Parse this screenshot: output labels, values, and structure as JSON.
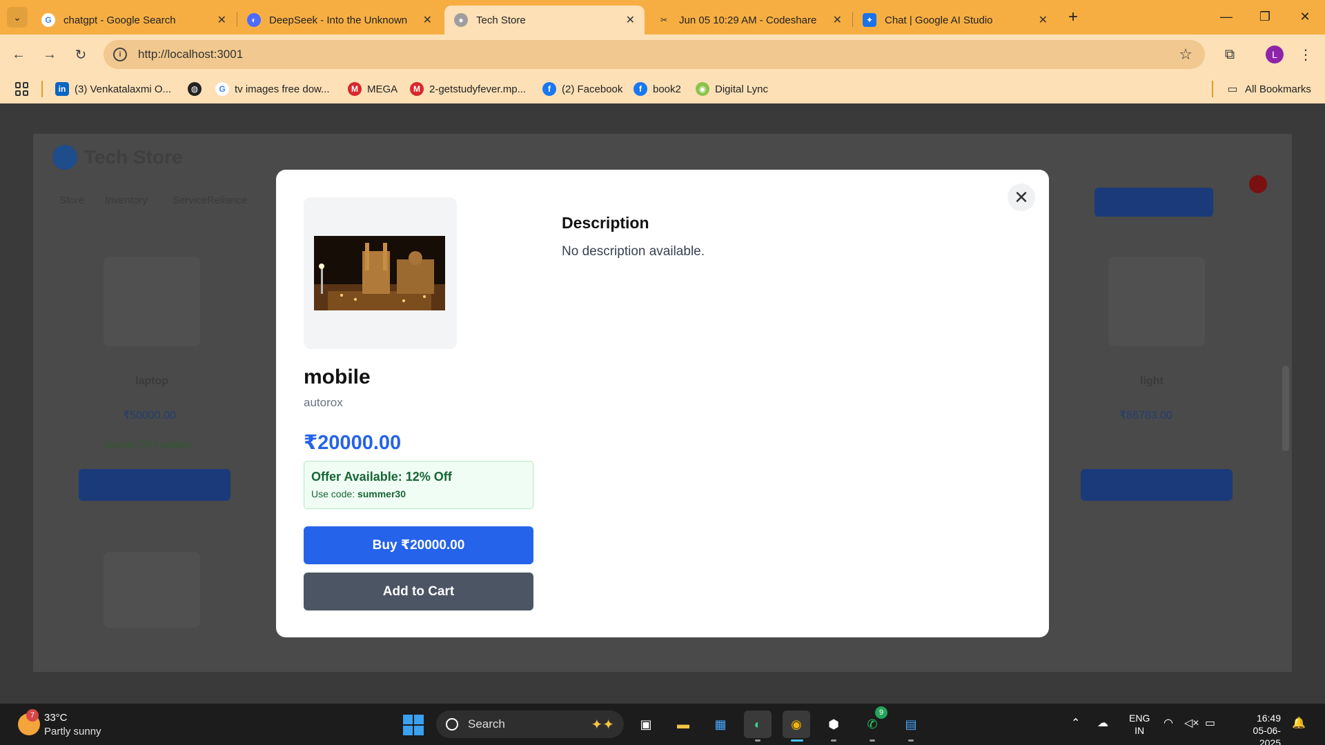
{
  "browser": {
    "tabs": [
      {
        "label": "chatgpt - Google Search",
        "icon": "google-icon",
        "active": false
      },
      {
        "label": "DeepSeek - Into the Unknown",
        "icon": "deepseek-icon",
        "active": false
      },
      {
        "label": "Tech Store",
        "icon": "globe-icon",
        "active": true
      },
      {
        "label": "Jun 05 10:29 AM - Codeshare",
        "icon": "codeshare-icon",
        "active": false
      },
      {
        "label": "Chat | Google AI Studio",
        "icon": "ai-studio-icon",
        "active": false
      }
    ],
    "url": "http://localhost:3001",
    "profile_initial": "L",
    "bookmarks": [
      {
        "label": "(3) Venkatalaxmi O...",
        "icon": "linkedin-icon"
      },
      {
        "label": "",
        "icon": "globe-icon"
      },
      {
        "label": "tv images free dow...",
        "icon": "google-icon"
      },
      {
        "label": "MEGA",
        "icon": "mega-icon"
      },
      {
        "label": "2-getstudyfever.mp...",
        "icon": "mega-icon"
      },
      {
        "label": "(2) Facebook",
        "icon": "facebook-icon"
      },
      {
        "label": "book2",
        "icon": "facebook-icon"
      },
      {
        "label": "Digital Lync",
        "icon": "digital-lync-icon"
      }
    ],
    "all_bookmarks": "All Bookmarks"
  },
  "modal": {
    "product_name": "mobile",
    "brand": "autorox",
    "price": "₹20000.00",
    "offer_title": "Offer Available: 12% Off",
    "offer_code_label": "Use code:",
    "offer_code": "summer30",
    "buy_label": "Buy ₹20000.00",
    "cart_label": "Add to Cart",
    "description_title": "Description",
    "description_text": "No description available."
  },
  "taskbar": {
    "weather_badge": "7",
    "temperature": "33°C",
    "weather": "Partly sunny",
    "search_label": "Search",
    "whatsapp_badge": "9",
    "lang_1": "ENG",
    "lang_2": "IN",
    "time": "16:49",
    "date": "05-06-2025"
  },
  "colors": {
    "tab_bar": "#f6ae43",
    "toolbar": "#fde0b6",
    "price_blue": "#2563eb",
    "offer_green": "#166534",
    "cart_gray": "#4b5563"
  }
}
